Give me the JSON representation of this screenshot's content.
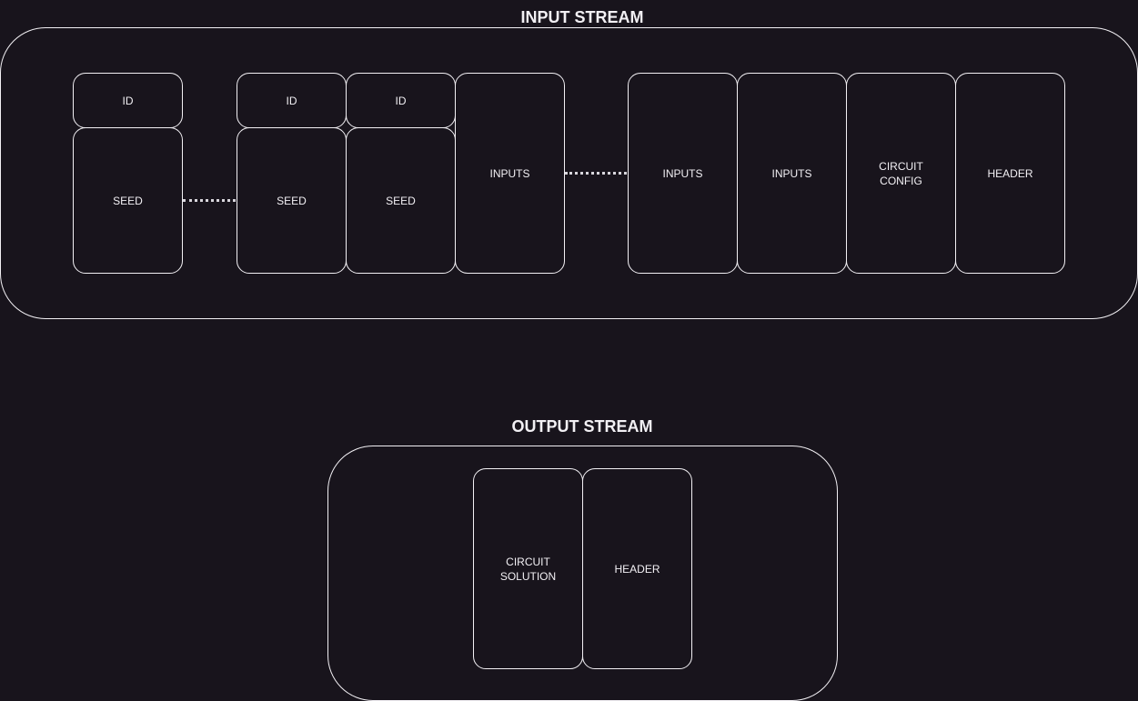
{
  "input_stream": {
    "title": "INPUT STREAM",
    "blocks": {
      "id_1": "ID",
      "seed_1": "SEED",
      "id_2": "ID",
      "seed_2": "SEED",
      "id_3": "ID",
      "seed_3": "SEED",
      "inputs_1": "INPUTS",
      "inputs_2": "INPUTS",
      "inputs_3": "INPUTS",
      "circuit_config": "CIRCUIT\nCONFIG",
      "header": "HEADER"
    }
  },
  "output_stream": {
    "title": "OUTPUT STREAM",
    "blocks": {
      "circuit_solution": "CIRCUIT\nSOLUTION",
      "header": "HEADER"
    }
  }
}
